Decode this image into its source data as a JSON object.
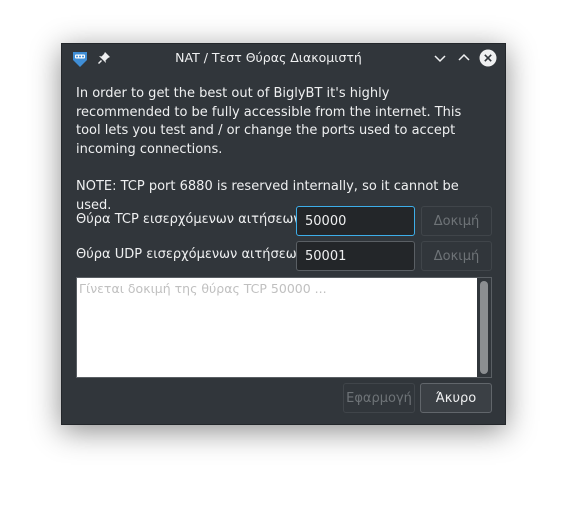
{
  "window": {
    "title": "NAT / Τεστ Θύρας Διακομιστή",
    "app_icon": "biglybt-icon",
    "pin_icon": "pin-icon",
    "controls": [
      "chevron-down-icon",
      "chevron-up-icon",
      "close-icon"
    ]
  },
  "description": "In order to get the best out of BiglyBT it's highly recommended to be fully accessible from the internet. This tool lets you test and / or change the ports used to accept incoming connections.",
  "note": "NOTE: TCP port 6880 is reserved internally, so it cannot be used.",
  "tcp": {
    "label": "Θύρα TCP εισερχόμενων αιτήσεων",
    "value": "50000",
    "test_label": "Δοκιμή"
  },
  "udp": {
    "label": "Θύρα UDP εισερχόμενων αιτήσεων",
    "value": "50001",
    "test_label": "Δοκιμή"
  },
  "log": {
    "text": "Γίνεται δοκιμή της θύρας TCP 50000 ..."
  },
  "buttons": {
    "apply": "Εφαρμογή",
    "cancel": "Άκυρο"
  },
  "colors": {
    "window_bg": "#31363b",
    "text": "#eff0f1",
    "focus_accent": "#3daee9",
    "disabled_text": "#6e7377",
    "close_button_bg": "#eff0f1"
  }
}
